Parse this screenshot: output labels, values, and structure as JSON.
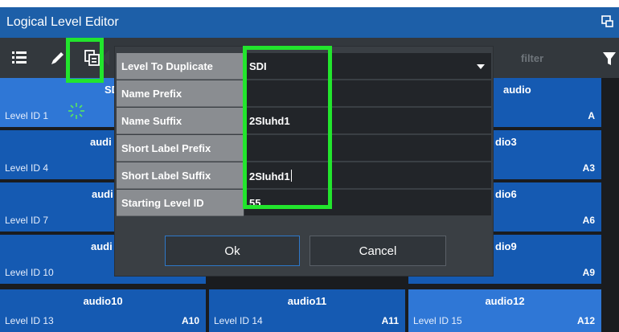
{
  "window": {
    "title": "Logical Level Editor",
    "restore_icon": "restore-window-icon"
  },
  "toolbar": {
    "icons": [
      "list-icon",
      "edit-icon",
      "duplicate-icon"
    ],
    "filter_placeholder": "filter",
    "filter_icon": "filter-icon"
  },
  "tiles": [
    {
      "name": "SD",
      "level_id": "Level ID 1",
      "code": ""
    },
    {
      "name": "audio",
      "level_id": "",
      "code": "A"
    },
    {
      "name": "audi",
      "level_id": "Level ID 4",
      "code": ""
    },
    {
      "name": "dio3",
      "level_id": "",
      "code": "A3"
    },
    {
      "name": "audi",
      "level_id": "Level ID 7",
      "code": ""
    },
    {
      "name": "dio6",
      "level_id": "",
      "code": "A6"
    },
    {
      "name": "audi",
      "level_id": "Level ID 10",
      "code": ""
    },
    {
      "name": "dio9",
      "level_id": "",
      "code": "A9"
    },
    {
      "name": "audio10",
      "level_id": "Level ID 13",
      "code": "A10"
    },
    {
      "name": "audio11",
      "level_id": "Level ID 14",
      "code": "A11"
    },
    {
      "name": "audio12",
      "level_id": "Level ID 15",
      "code": "A12"
    }
  ],
  "dialog": {
    "rows": [
      {
        "label": "Level To Duplicate",
        "value": "SDI"
      },
      {
        "label": "Name Prefix",
        "value": ""
      },
      {
        "label": "Name Suffix",
        "value": "2SIuhd1"
      },
      {
        "label": "Short Label Prefix",
        "value": ""
      },
      {
        "label": "Short Label Suffix",
        "value": "2SIuhd1"
      },
      {
        "label": "Starting Level ID",
        "value": "55"
      }
    ],
    "ok_label": "Ok",
    "cancel_label": "Cancel"
  },
  "colors": {
    "accent": "#155ab2",
    "title_bar": "#1d5fa8",
    "highlight": "#22e52d",
    "dialog_bg": "#3a3f44"
  }
}
